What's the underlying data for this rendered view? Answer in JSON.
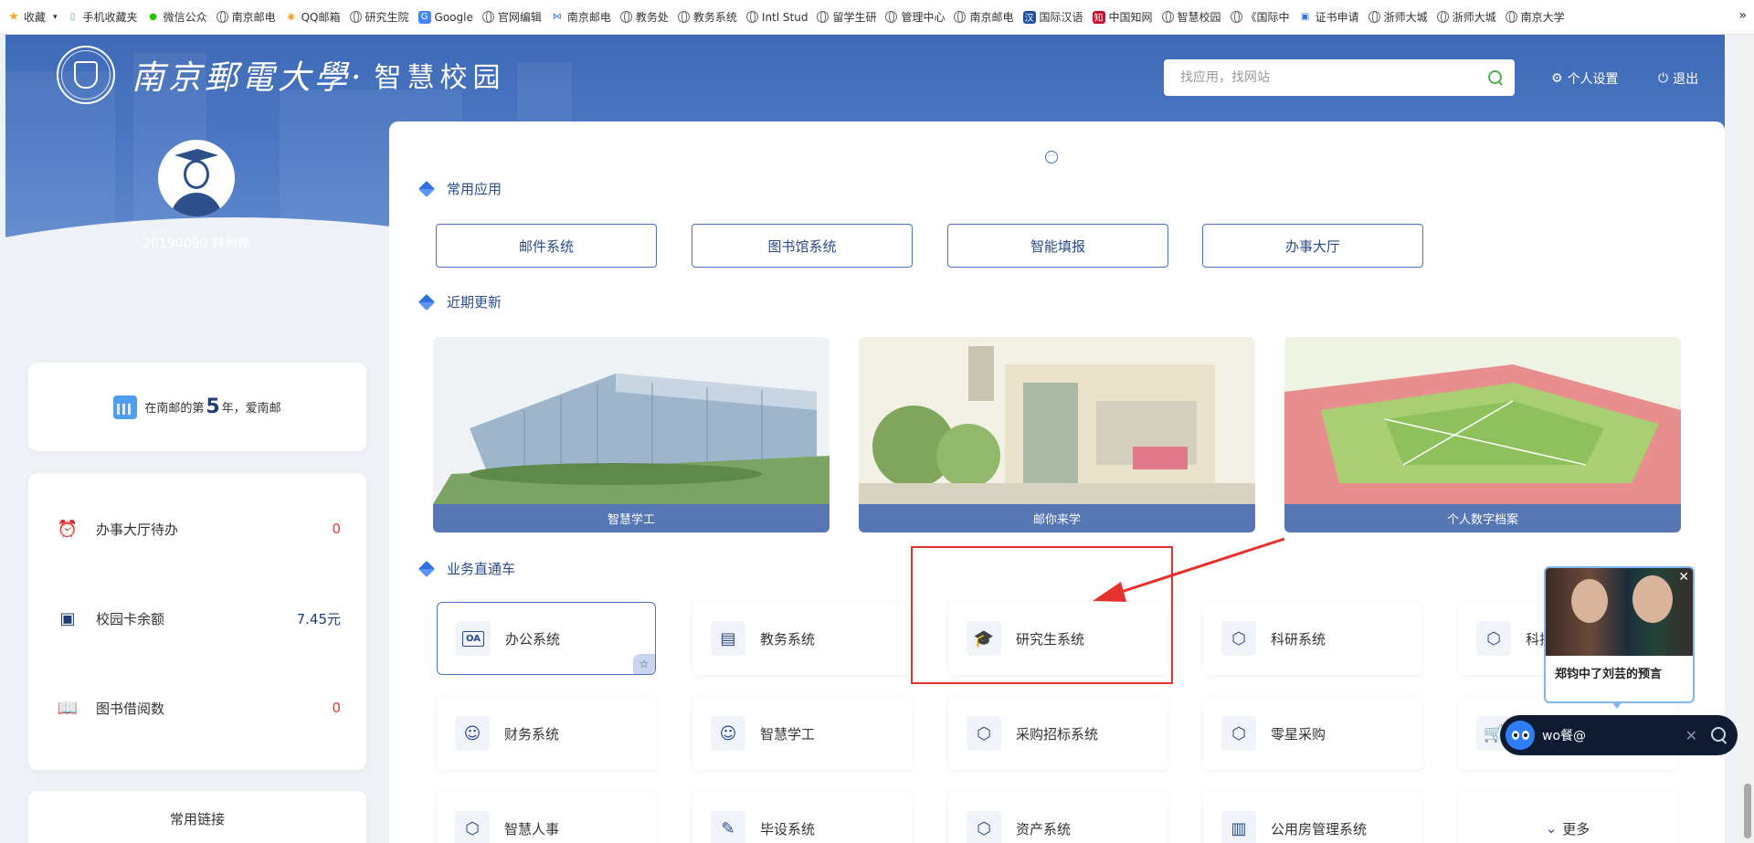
{
  "bookmarks": {
    "items": [
      {
        "label": "收藏",
        "icon": "star-icon"
      },
      {
        "label": "手机收藏夹",
        "icon": "phone-icon"
      },
      {
        "label": "微信公众",
        "icon": "wechat-icon"
      },
      {
        "label": "南京邮电",
        "icon": "globe-icon"
      },
      {
        "label": "QQ邮箱",
        "icon": "qq-mail-icon"
      },
      {
        "label": "研究生院",
        "icon": "globe-icon"
      },
      {
        "label": "Google",
        "icon": "google-icon"
      },
      {
        "label": "官网编辑",
        "icon": "globe-icon"
      },
      {
        "label": "南京邮电",
        "icon": "njupt-icon"
      },
      {
        "label": "教务处",
        "icon": "globe-icon"
      },
      {
        "label": "教务系统",
        "icon": "globe-icon"
      },
      {
        "label": "Intl Stud",
        "icon": "globe-icon"
      },
      {
        "label": "留学生研",
        "icon": "globe-icon"
      },
      {
        "label": "管理中心",
        "icon": "globe-icon"
      },
      {
        "label": "南京邮电",
        "icon": "globe-icon"
      },
      {
        "label": "国际汉语",
        "icon": "hanban-icon"
      },
      {
        "label": "中国知网",
        "icon": "cnki-icon"
      },
      {
        "label": "智慧校园",
        "icon": "globe-icon"
      },
      {
        "label": "《国际中",
        "icon": "globe-icon"
      },
      {
        "label": "证书申请",
        "icon": "cert-icon"
      },
      {
        "label": "浙师大城",
        "icon": "globe-icon"
      },
      {
        "label": "浙师大城",
        "icon": "globe-icon"
      },
      {
        "label": "南京大学",
        "icon": "globe-icon"
      }
    ],
    "overflow": "»"
  },
  "header": {
    "logo_text": "南京郵電大學·",
    "logo_sub": "智慧校园",
    "search_placeholder": "找应用，找网站",
    "settings_label": "个人设置",
    "logout_label": "退出"
  },
  "user": {
    "id_name": "20190090 林雨婷"
  },
  "years": {
    "prefix": "在南邮的第",
    "count": "5",
    "suffix": "年，爱南邮"
  },
  "stats": [
    {
      "label": "办事大厅待办",
      "value": "0",
      "icon": "alarm-clock-icon"
    },
    {
      "label": "校园卡余额",
      "value": "7.45元",
      "icon": "wallet-icon"
    },
    {
      "label": "图书借阅数",
      "value": "0",
      "icon": "book-icon"
    }
  ],
  "links_title": "常用链接",
  "sections": {
    "common": "常用应用",
    "recent": "近期更新",
    "business": "业务直通车"
  },
  "common_apps": [
    "邮件系统",
    "图书馆系统",
    "智能填报",
    "办事大厅"
  ],
  "recent_updates": [
    "智慧学工",
    "邮你来学",
    "个人数字档案"
  ],
  "business_tiles": [
    {
      "label": "办公系统",
      "icon": "oa-icon",
      "icon_text": "OA"
    },
    {
      "label": "教务系统",
      "icon": "printer-icon"
    },
    {
      "label": "研究生系统",
      "icon": "graduation-cap-icon"
    },
    {
      "label": "科研系统",
      "icon": "cube-icon"
    },
    {
      "label": "科技",
      "icon": "cube-icon"
    },
    {
      "label": "财务系统",
      "icon": "person-icon"
    },
    {
      "label": "智慧学工",
      "icon": "person-icon"
    },
    {
      "label": "采购招标系统",
      "icon": "cube-icon"
    },
    {
      "label": "零星采购",
      "icon": "cube-icon"
    },
    {
      "label": "",
      "icon": "cart-icon"
    },
    {
      "label": "智慧人事",
      "icon": "cube-icon"
    },
    {
      "label": "毕设系统",
      "icon": "tools-icon"
    },
    {
      "label": "资产系统",
      "icon": "cube-icon"
    },
    {
      "label": "公用房管理系统",
      "icon": "building-icon"
    },
    {
      "label": "更多",
      "icon": "chevron-down-circle-icon"
    }
  ],
  "popup": {
    "title": "郑钧中了刘芸的预言"
  },
  "ai_bar": {
    "text": "wo餐@"
  },
  "colors": {
    "primary": "#4a74c0",
    "banner": "#3e69b6",
    "highlight": "#e5322d",
    "accent_value": "#e53935"
  }
}
